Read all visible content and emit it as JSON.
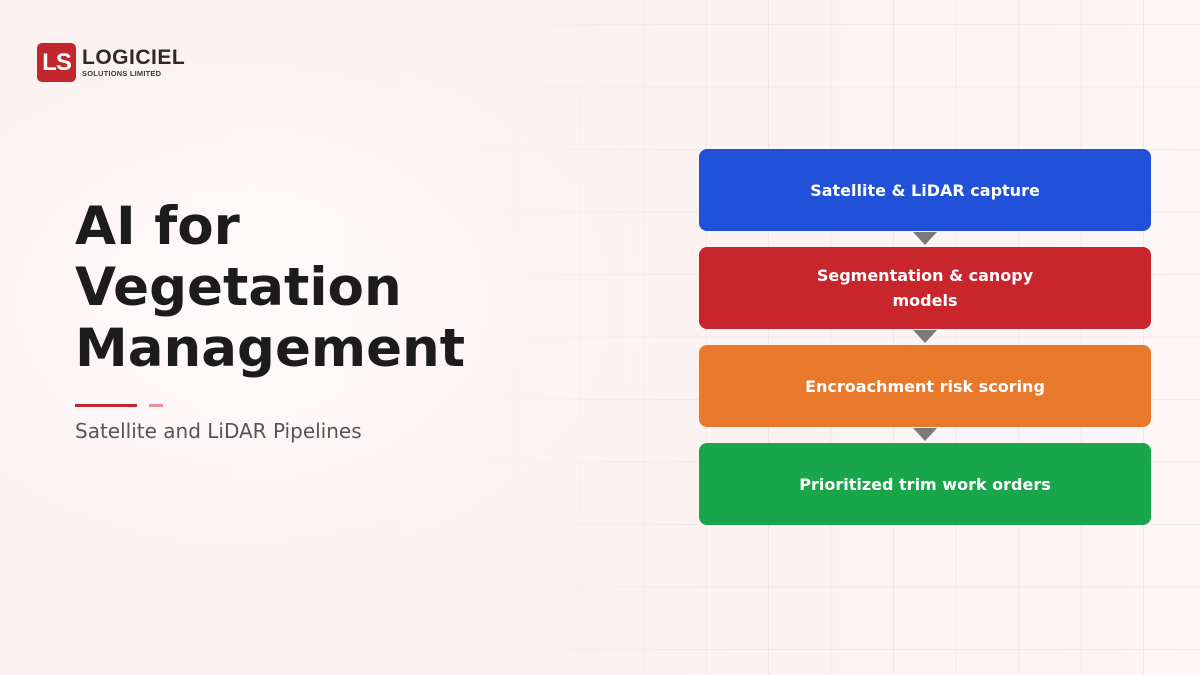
{
  "logo": {
    "mark": "LS",
    "name": "LOGICIEL",
    "subtitle": "SOLUTIONS LIMITED",
    "brand_color": "#c1272d"
  },
  "title": "AI for Vegetation Management",
  "subtitle": "Satellite and LiDAR Pipelines",
  "flow": {
    "steps": [
      {
        "label": "Satellite & LiDAR capture",
        "color": "#2150d9"
      },
      {
        "label": "Segmentation & canopy models",
        "color": "#c9252d"
      },
      {
        "label": "Encroachment risk scoring",
        "color": "#e8792b"
      },
      {
        "label": "Prioritized trim work orders",
        "color": "#19a54a"
      }
    ],
    "arrow_color": "#7a7a7a"
  }
}
